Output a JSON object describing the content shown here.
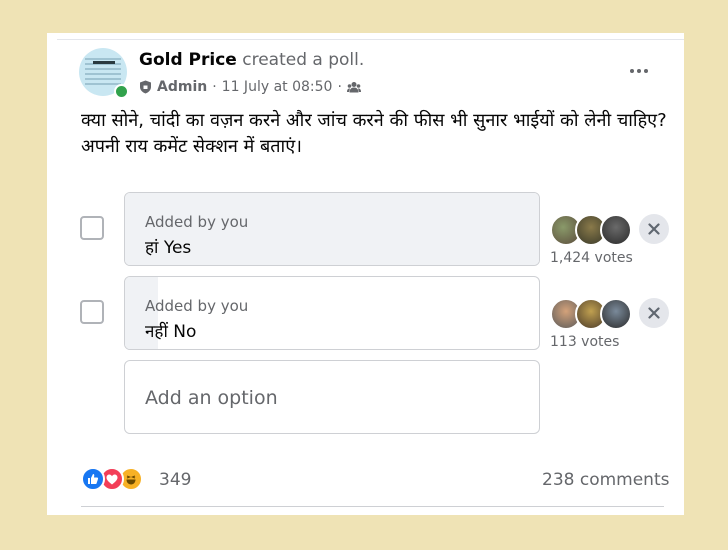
{
  "post": {
    "group_name": "Gold Price",
    "action": "created a poll.",
    "role": "Admin",
    "date": "11 July at 08:50",
    "separator": "·",
    "text": "क्या सोने, चांदी का वज़न करने और जांच करने की फीस भी सुनार भाईयों को लेनी चाहिए? अपनी राय कमेंट सेक्शन में बताएं।"
  },
  "poll": {
    "options": [
      {
        "added_by": "Added by you",
        "label": "हां Yes",
        "votes": "1,424 votes",
        "fill_fraction": 1.0
      },
      {
        "added_by": "Added by you",
        "label": "नहीं No",
        "votes": "113 votes",
        "fill_fraction": 0.079
      }
    ],
    "add_option_placeholder": "Add an option"
  },
  "footer": {
    "reaction_count": "349",
    "comments": "238 comments",
    "reactions": [
      "like-icon",
      "love-icon",
      "haha-icon"
    ]
  },
  "colors": {
    "page_background": "#efe3b5",
    "like": "#1877f2",
    "love": "#f33e58",
    "haha": "#f7b125",
    "online": "#31a24c"
  }
}
